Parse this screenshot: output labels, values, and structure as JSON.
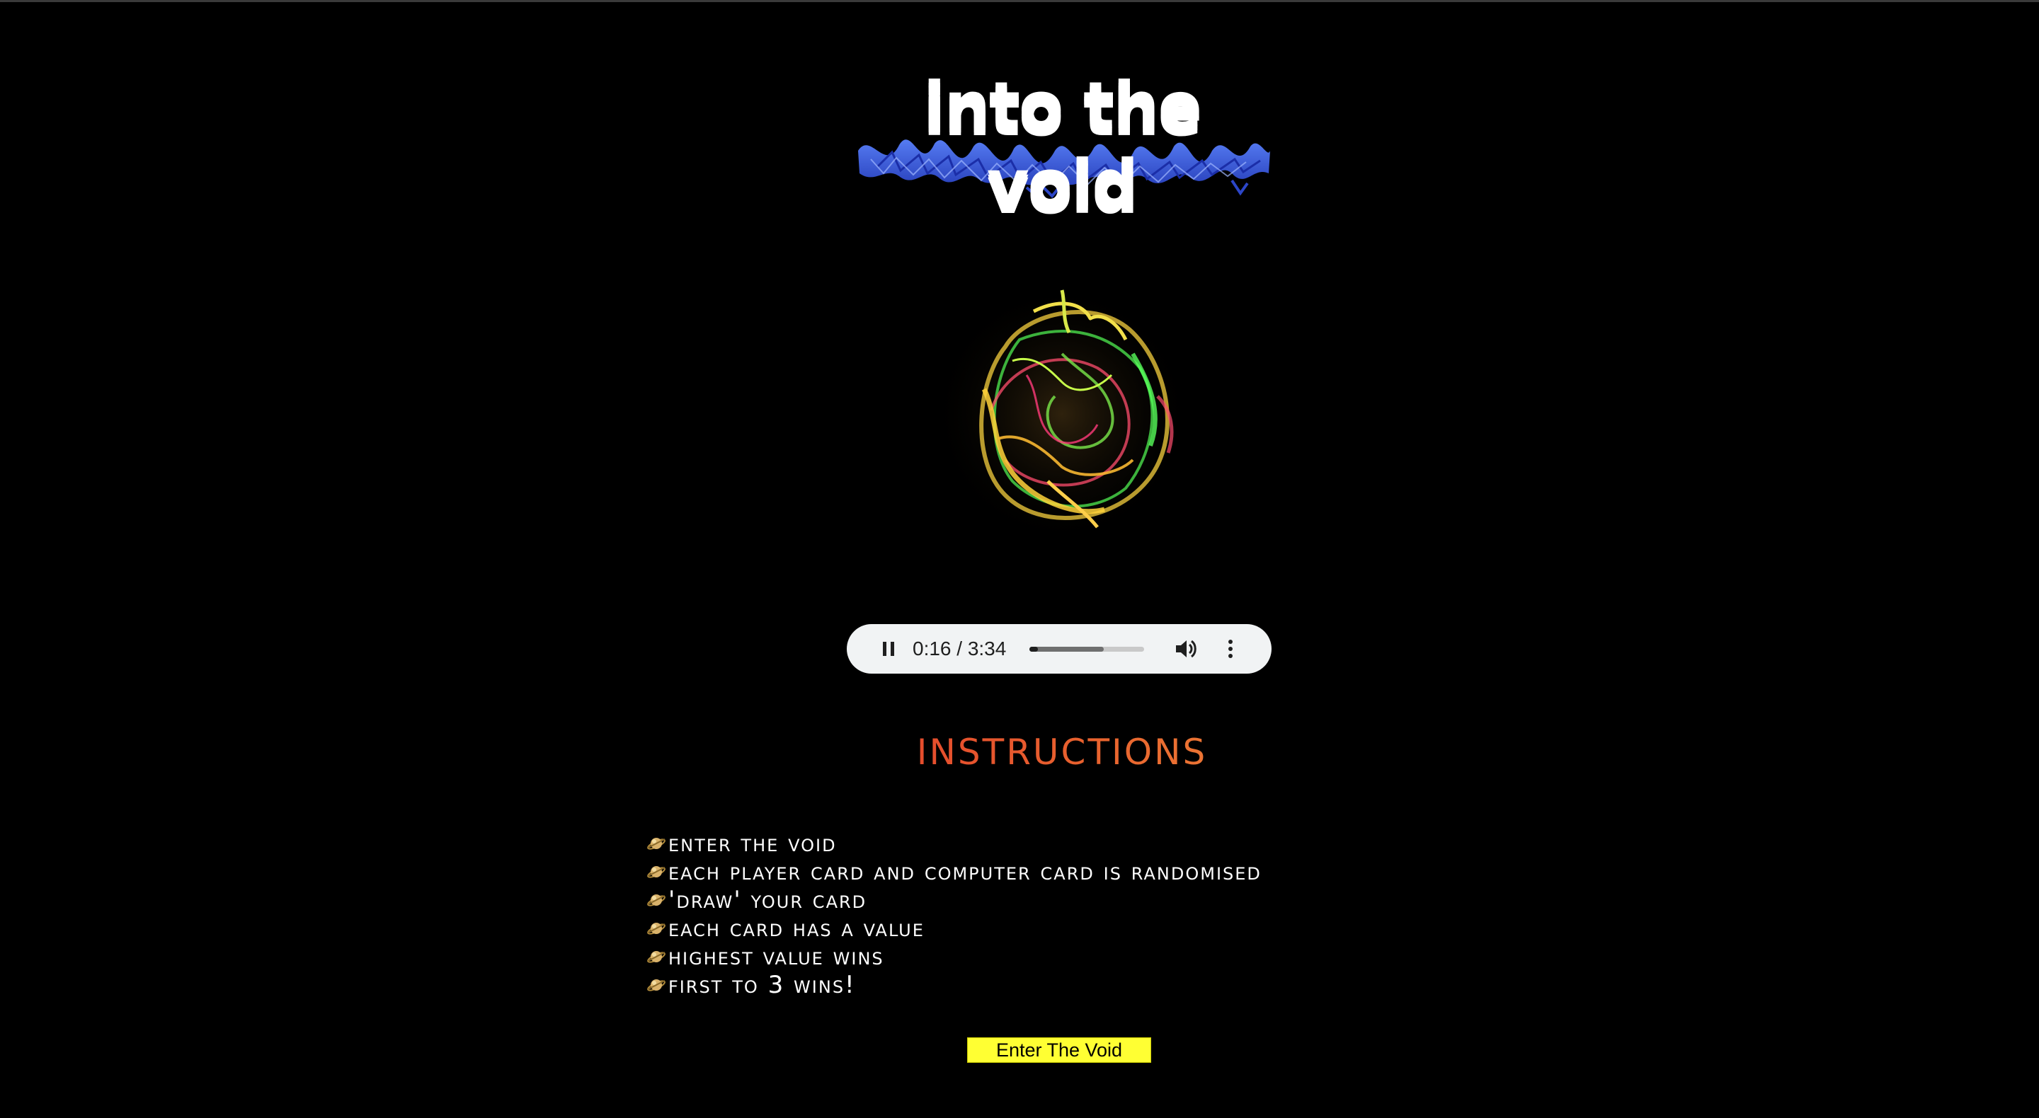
{
  "logo": {
    "text": "into the void"
  },
  "audio_player": {
    "time": "0:16 / 3:34",
    "progress_fraction": 0.075,
    "buffered_fraction": 0.65,
    "state": "playing",
    "icons": [
      "pause-icon",
      "volume-icon",
      "more-vert-icon"
    ]
  },
  "instructions": {
    "heading": "instructions",
    "items": [
      {
        "label": "Enter the Void",
        "icon": "planet-icon"
      },
      {
        "label": "Each player card and computer card is randomised",
        "icon": "planet-icon"
      },
      {
        "label": "'Draw' your card",
        "icon": "planet-icon"
      },
      {
        "label": "Each card has a value",
        "icon": "planet-icon"
      },
      {
        "label": "Highest value wins",
        "icon": "planet-icon"
      },
      {
        "label": "First to 3 wins!",
        "icon": "planet-icon"
      }
    ]
  },
  "enter_button": {
    "label": "Enter The Void"
  },
  "colors": {
    "background": "#000000",
    "heading_gradient_start": "#e23c2c",
    "heading_gradient_end": "#f08a3a",
    "button_bg": "#ffff33",
    "logo_flame": "#3b5fe0",
    "player_bg": "#f1f3f4"
  }
}
